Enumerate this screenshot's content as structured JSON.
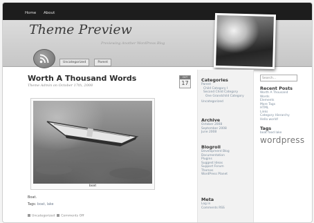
{
  "nav": {
    "items": [
      "Home",
      "About"
    ]
  },
  "header": {
    "title": "Theme Preview",
    "description": "Previewing Another WordPress Blog",
    "tabs": [
      "Uncategorized",
      "Parent"
    ]
  },
  "post": {
    "title": "Worth A Thousand Words",
    "meta": "Theme Admin on October 17th, 2008",
    "date_month": "OCT",
    "date_day": "17",
    "image_caption": "boat",
    "excerpt": "Boat.",
    "tags_label": "Tags:",
    "tags": "boat, lake",
    "category": "Uncategorized",
    "comments": "Comments Off"
  },
  "sidebar1": {
    "categories": {
      "title": "Categories",
      "items": [
        {
          "label": "Parent",
          "level": 1
        },
        {
          "label": "Child Category I",
          "level": 2
        },
        {
          "label": "Second Child Category",
          "level": 2
        },
        {
          "label": "One Grandchild Category",
          "level": 3
        },
        {
          "label": "Uncategorized",
          "level": 1
        }
      ]
    },
    "archive": {
      "title": "Archive",
      "items": [
        "October 2008",
        "September 2008",
        "June 2008"
      ]
    },
    "blogroll": {
      "title": "Blogroll",
      "items": [
        "Development Blog",
        "Documentation",
        "Plugins",
        "Suggest Ideas",
        "Support Forum",
        "Themes",
        "WordPress Planet"
      ]
    },
    "meta": {
      "title": "Meta",
      "items": [
        "Log in",
        "Comments RSS"
      ]
    }
  },
  "sidebar2": {
    "search_placeholder": "Search...",
    "recent": {
      "title": "Recent Posts",
      "items": [
        "Worth A Thousand Words",
        "Elements",
        "More Tags",
        "HTML",
        "Links",
        "Category Hierarchy",
        "Hello world!"
      ]
    },
    "tags": {
      "title": "Tags",
      "small": "boat food lake",
      "big": "wordpress"
    }
  }
}
